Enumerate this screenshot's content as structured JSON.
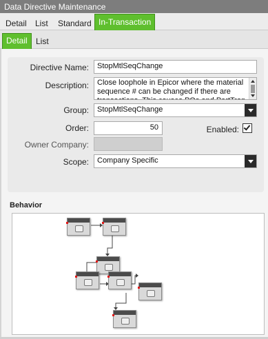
{
  "window": {
    "title": "Data Directive Maintenance"
  },
  "top_tabs": [
    "Detail",
    "List",
    "Standard",
    "In-Transaction"
  ],
  "sub_tabs": [
    "Detail",
    "List"
  ],
  "form": {
    "directive_name_label": "Directive Name:",
    "directive_name_value": "StopMtlSeqChange",
    "description_label": "Description:",
    "description_value": "Close loophole in Epicor where the material sequence # can be changed if there are transactions.  This causes POs and PartTran",
    "group_label": "Group:",
    "group_value": "StopMtlSeqChange",
    "order_label": "Order:",
    "order_value": "50",
    "enabled_label": "Enabled:",
    "enabled_checked": true,
    "owner_company_label": "Owner Company:",
    "owner_company_value": "",
    "scope_label": "Scope:",
    "scope_value": "Company Specific"
  },
  "behavior": {
    "title": "Behavior"
  },
  "colors": {
    "active_tab": "#5fbf2e",
    "title_bar": "#7d7d7d"
  }
}
